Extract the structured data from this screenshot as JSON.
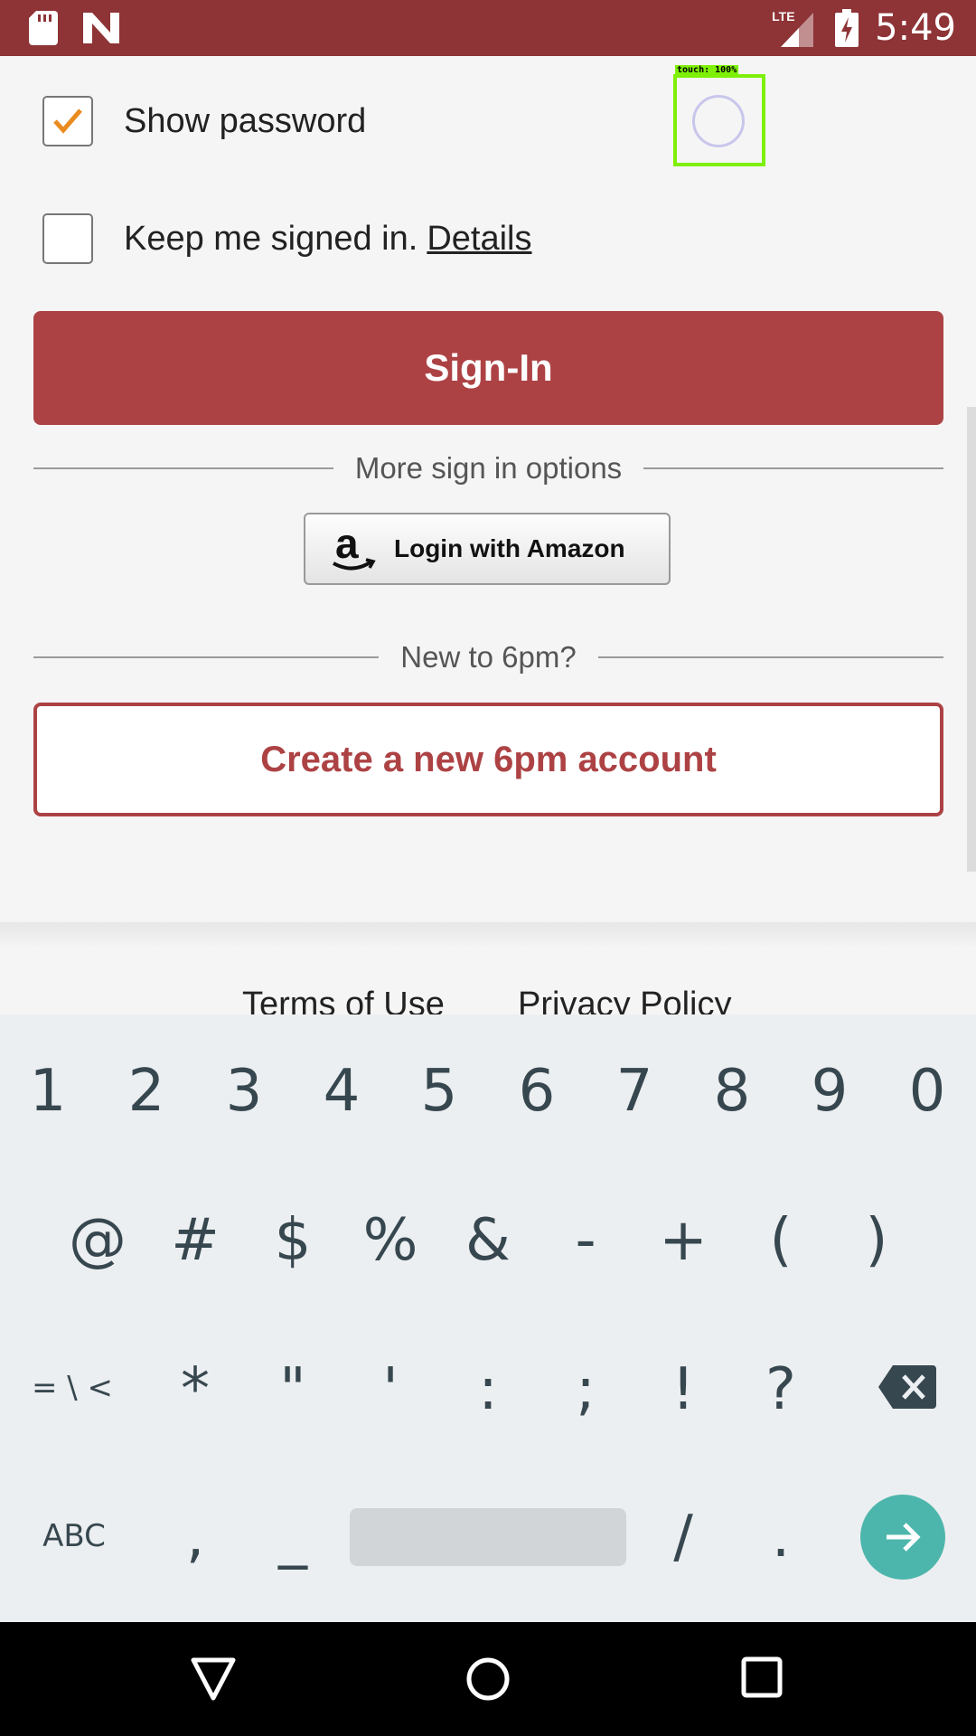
{
  "status_bar": {
    "time": "5:49",
    "network": "LTE",
    "icons": [
      "sd-card-icon",
      "n-notification-icon",
      "signal-icon",
      "battery-charging-icon"
    ]
  },
  "form": {
    "show_password_label": "Show password",
    "show_password_checked": true,
    "keep_signed_in_label": "Keep me signed in.",
    "keep_signed_in_checked": false,
    "details_link": "Details",
    "signin_button": "Sign-In",
    "more_options_text": "More sign in options",
    "amazon_button": "Login with Amazon",
    "new_to_text": "New to 6pm?",
    "create_account_button": "Create a new 6pm account"
  },
  "footer": {
    "terms": "Terms of Use",
    "privacy": "Privacy Policy"
  },
  "touch_indicator": {
    "label": "touch: 100%"
  },
  "keyboard": {
    "row1": [
      "1",
      "2",
      "3",
      "4",
      "5",
      "6",
      "7",
      "8",
      "9",
      "0"
    ],
    "row2": [
      "@",
      "#",
      "$",
      "%",
      "&",
      "-",
      "+",
      "(",
      ")"
    ],
    "row3": [
      "= \\ <",
      "*",
      "\"",
      "'",
      ":",
      ";",
      "!",
      "?"
    ],
    "row4": [
      "ABC",
      ",",
      "_",
      "/",
      "."
    ]
  },
  "colors": {
    "brand": "#ad4244",
    "status_bar": "#8e3336",
    "checkmark": "#e98b1f",
    "enter_key": "#4db6ac"
  }
}
